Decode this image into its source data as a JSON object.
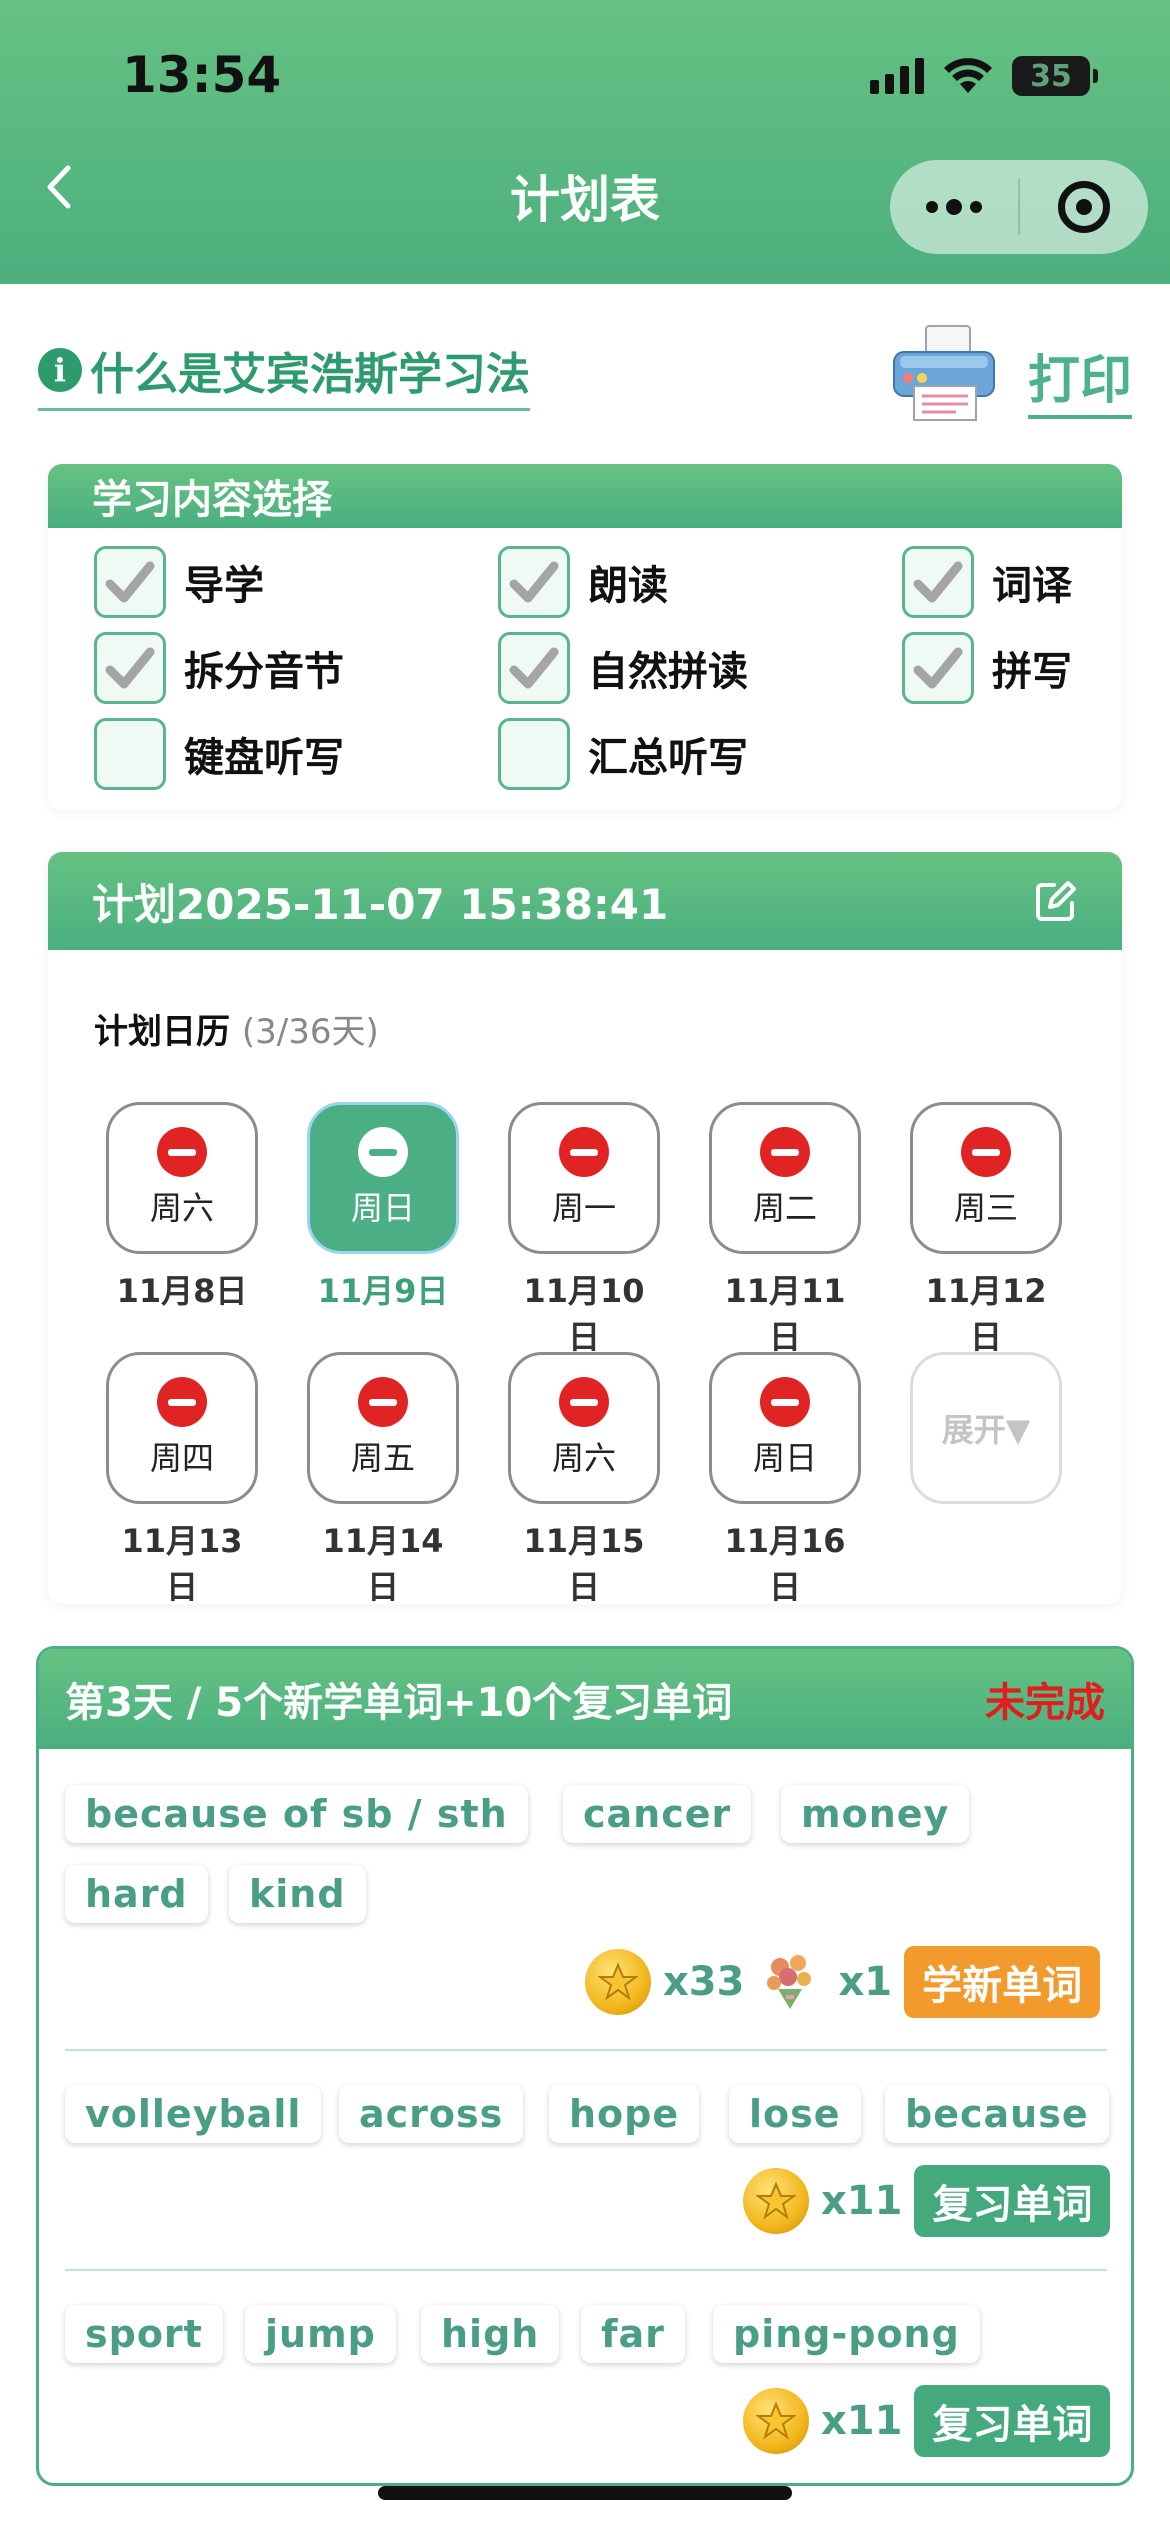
{
  "status_bar": {
    "time": "13:54",
    "battery": "35"
  },
  "nav": {
    "title": "计划表"
  },
  "info": {
    "icon_text": "i",
    "link_text": "什么是艾宾浩斯学习法",
    "print_label": "打印"
  },
  "content_select": {
    "title": "学习内容选择",
    "options": [
      {
        "label": "导学",
        "checked": true
      },
      {
        "label": "朗读",
        "checked": true
      },
      {
        "label": "词译",
        "checked": true
      },
      {
        "label": "拆分音节",
        "checked": true
      },
      {
        "label": "自然拼读",
        "checked": true
      },
      {
        "label": "拼写",
        "checked": true
      },
      {
        "label": "键盘听写",
        "checked": false
      },
      {
        "label": "汇总听写",
        "checked": false
      }
    ]
  },
  "plan": {
    "title": "计划2025-11-07 15:38:41",
    "calendar_label": "计划日历",
    "calendar_progress": "(3/36天)",
    "days": [
      {
        "weekday": "周六",
        "date": "11月8日"
      },
      {
        "weekday": "周日",
        "date": "11月9日",
        "selected": true
      },
      {
        "weekday": "周一",
        "date": "11月10日"
      },
      {
        "weekday": "周二",
        "date": "11月11日"
      },
      {
        "weekday": "周三",
        "date": "11月12日"
      },
      {
        "weekday": "周四",
        "date": "11月13日"
      },
      {
        "weekday": "周五",
        "date": "11月14日"
      },
      {
        "weekday": "周六",
        "date": "11月15日"
      },
      {
        "weekday": "周日",
        "date": "11月16日"
      }
    ],
    "expand_label": "展开▼"
  },
  "task": {
    "title": "第3天 / 5个新学单词+10个复习单词",
    "status": "未完成",
    "groups": [
      {
        "words": [
          "because of sb / sth",
          "cancer",
          "money",
          "hard",
          "kind"
        ],
        "coins": "x33",
        "gift_count": "x1",
        "button": "学新单词"
      },
      {
        "words": [
          "volleyball",
          "across",
          "hope",
          "lose",
          "because"
        ],
        "coins": "x11",
        "button": "复习单词"
      },
      {
        "words": [
          "sport",
          "jump",
          "high",
          "far",
          "ping-pong"
        ],
        "coins": "x11",
        "button": "复习单词"
      }
    ]
  },
  "colors": {
    "primary_green": "#4cae84",
    "header_green": "#66c283",
    "danger_red": "#e02424",
    "orange": "#f29b2c"
  }
}
